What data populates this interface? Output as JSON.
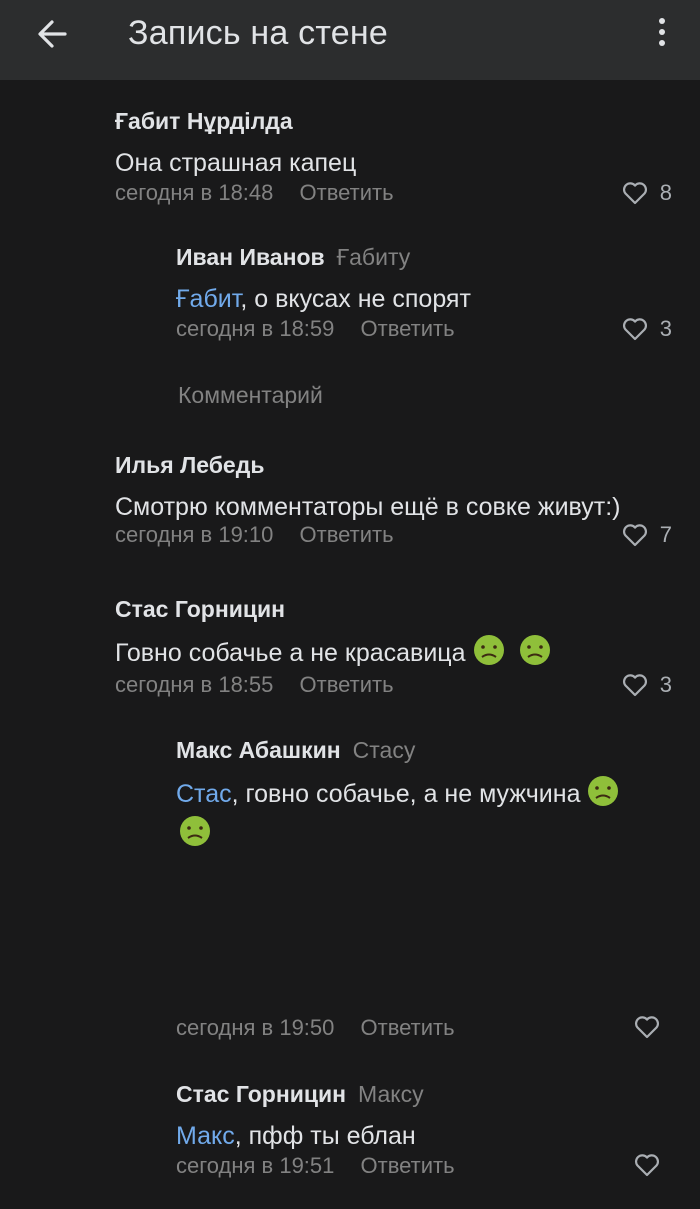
{
  "header": {
    "title": "Запись на стене",
    "back_icon": "arrow-left-icon",
    "menu_icon": "more-vertical-icon"
  },
  "colors": {
    "background": "#19191a",
    "header_bg": "#2c2d2e",
    "text_primary": "#e1e3e6",
    "text_secondary": "#828282",
    "link": "#71aaeb"
  },
  "comments": [
    {
      "author": "Ғабит Нұрділда",
      "reply_to": "",
      "mention": "",
      "text": "Она страшная капец",
      "time": "сегодня в 18:48",
      "reply_label": "Ответить",
      "likes": "8"
    },
    {
      "author": "Иван Иванов",
      "reply_to": "Ғабиту",
      "mention": "Ғабит",
      "text": ", о вкусах не спорят",
      "time": "сегодня в 18:59",
      "reply_label": "Ответить",
      "likes": "3"
    },
    {
      "author": "Илья Лебедь",
      "reply_to": "",
      "mention": "",
      "text": "Смотрю комментаторы ещё в совке живут:)",
      "time": "сегодня в 19:10",
      "reply_label": "Ответить",
      "likes": "7"
    },
    {
      "author": "Стас Горницин",
      "reply_to": "",
      "mention": "",
      "text": "Говно собачье а не красавица",
      "time": "сегодня в 18:55",
      "reply_label": "Ответить",
      "likes": "3"
    },
    {
      "author": "Макс Абашкин",
      "reply_to": "Стасу",
      "mention": "Стас",
      "text": ", говно собачье, а не мужчина",
      "time": "сегодня в 19:50",
      "reply_label": "Ответить",
      "likes": ""
    },
    {
      "author": "Стас Горницин",
      "reply_to": "Максу",
      "mention": "Макс",
      "text": ", пфф ты еблан",
      "time": "сегодня в 19:51",
      "reply_label": "Ответить",
      "likes": ""
    }
  ],
  "compose": {
    "placeholder": "Комментарий"
  },
  "emoji_icon": "nauseated-face-emoji"
}
